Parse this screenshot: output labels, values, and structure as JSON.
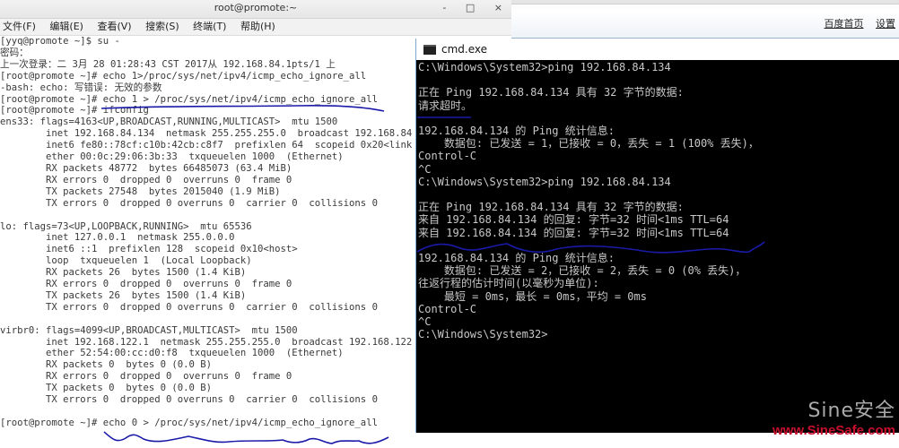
{
  "browser": {
    "links": [
      "百度首页",
      "设置"
    ]
  },
  "terminal": {
    "title": "root@promote:~",
    "window_controls": [
      "-",
      "□",
      "×"
    ],
    "menu": [
      "文件(F)",
      "编辑(E)",
      "查看(V)",
      "搜索(S)",
      "终端(T)",
      "帮助(H)"
    ],
    "lines": [
      "[yyq@promote ~]$ su -",
      "密码：",
      "上一次登录：二 3月 28 01:28:43 CST 2017从 192.168.84.1pts/1 上",
      "[root@promote ~]# echo 1>/proc/sys/net/ipv4/icmp_echo_ignore_all",
      "-bash: echo: 写错误: 无效的参数",
      "[root@promote ~]# echo 1 > /proc/sys/net/ipv4/icmp_echo_ignore_all",
      "[root@promote ~]# ifconfig",
      "ens33: flags=4163<UP,BROADCAST,RUNNING,MULTICAST>  mtu 1500",
      "        inet 192.168.84.134  netmask 255.255.255.0  broadcast 192.168.84",
      "        inet6 fe80::78cf:c10b:42cb:c8f7  prefixlen 64  scopeid 0x20<link",
      "        ether 00:0c:29:06:3b:33  txqueuelen 1000  (Ethernet)",
      "        RX packets 48772  bytes 66485073 (63.4 MiB)",
      "        RX errors 0  dropped 0  overruns 0  frame 0",
      "        TX packets 27548  bytes 2015040 (1.9 MiB)",
      "        TX errors 0  dropped 0 overruns 0  carrier 0  collisions 0",
      "",
      "lo: flags=73<UP,LOOPBACK,RUNNING>  mtu 65536",
      "        inet 127.0.0.1  netmask 255.0.0.0",
      "        inet6 ::1  prefixlen 128  scopeid 0x10<host>",
      "        loop  txqueuelen 1  (Local Loopback)",
      "        RX packets 26  bytes 1500 (1.4 KiB)",
      "        RX errors 0  dropped 0  overruns 0  frame 0",
      "        TX packets 26  bytes 1500 (1.4 KiB)",
      "        TX errors 0  dropped 0 overruns 0  carrier 0  collisions 0",
      "",
      "virbr0: flags=4099<UP,BROADCAST,MULTICAST>  mtu 1500",
      "        inet 192.168.122.1  netmask 255.255.255.0  broadcast 192.168.122",
      "        ether 52:54:00:cc:d0:f8  txqueuelen 1000  (Ethernet)",
      "        RX packets 0  bytes 0 (0.0 B)",
      "        RX errors 0  dropped 0  overruns 0  frame 0",
      "        TX packets 0  bytes 0 (0.0 B)",
      "        TX errors 0  dropped 0 overruns 0  carrier 0  collisions 0",
      "",
      "[root@promote ~]# echo 0 > /proc/sys/net/ipv4/icmp_echo_ignore_all"
    ]
  },
  "cmd": {
    "title": "cmd.exe",
    "lines": [
      "C:\\Windows\\System32>ping 192.168.84.134",
      "",
      "正在 Ping 192.168.84.134 具有 32 字节的数据:",
      "请求超时。",
      "",
      "192.168.84.134 的 Ping 统计信息:",
      "    数据包: 已发送 = 1，已接收 = 0，丢失 = 1 (100% 丢失)，",
      "Control-C",
      "^C",
      "C:\\Windows\\System32>ping 192.168.84.134",
      "",
      "正在 Ping 192.168.84.134 具有 32 字节的数据:",
      "来自 192.168.84.134 的回复: 字节=32 时间<1ms TTL=64",
      "来自 192.168.84.134 的回复: 字节=32 时间<1ms TTL=64",
      "",
      "192.168.84.134 的 Ping 统计信息:",
      "    数据包: 已发送 = 2，已接收 = 2，丢失 = 0 (0% 丢失)，",
      "往返行程的估计时间(以毫秒为单位):",
      "    最短 = 0ms，最长 = 0ms，平均 = 0ms",
      "Control-C",
      "^C",
      "C:\\Windows\\System32>"
    ]
  },
  "watermark": {
    "logo": "Sine安全",
    "url": "www.SineSafe.com"
  },
  "colors": {
    "annotation_ink": "#1a1aa8",
    "watermark_url": "#c8102e"
  }
}
